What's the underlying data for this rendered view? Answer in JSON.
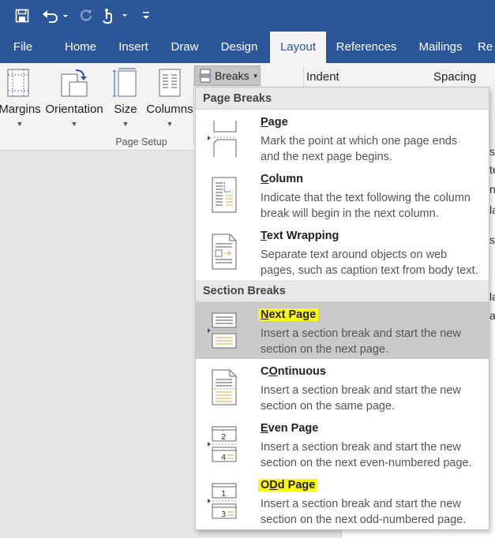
{
  "tabs": [
    "File",
    "Home",
    "Insert",
    "Draw",
    "Design",
    "Layout",
    "References",
    "Mailings",
    "Re"
  ],
  "active_tab": "Layout",
  "ribbon": {
    "margins": "Margins",
    "orientation": "Orientation",
    "size": "Size",
    "columns": "Columns",
    "group_label": "Page Setup",
    "breaks": "Breaks",
    "indent": "Indent",
    "spacing": "Spacing"
  },
  "doc_fragments": [
    "s",
    "te",
    "n",
    "la",
    "s",
    "la",
    "ar"
  ],
  "breaks_menu": {
    "page_breaks_header": "Page Breaks",
    "section_breaks_header": "Section Breaks",
    "items": [
      {
        "title_accel": "P",
        "title_rest": "age",
        "desc": [
          "Mark the point at which one page ends",
          "and the next page begins."
        ],
        "icon": "page-break-icon"
      },
      {
        "title_accel": "C",
        "title_rest": "olumn",
        "desc": [
          "Indicate that the text following the column",
          "break will begin in the next column."
        ],
        "icon": "column-break-icon"
      },
      {
        "title_accel": "T",
        "title_rest": "ext Wrapping",
        "desc": [
          "Separate text around objects on web",
          "pages, such as caption text from body text."
        ],
        "icon": "text-wrapping-icon"
      },
      {
        "title_accel": "N",
        "title_rest": "ext Page",
        "desc": [
          "Insert a section break and start the new",
          "section on the next page."
        ],
        "icon": "next-page-icon",
        "highlighted": true,
        "hover": true
      },
      {
        "title_accel": "O",
        "title_rest": "ntinuous",
        "title_pre": "C",
        "desc": [
          "Insert a section break and start the new",
          "section on the same page."
        ],
        "icon": "continuous-icon"
      },
      {
        "title_accel": "E",
        "title_rest": "ven Page",
        "desc": [
          "Insert a section break and start the new",
          "section on the next even-numbered page."
        ],
        "icon": "even-page-icon",
        "icon_number": "2"
      },
      {
        "title_accel": "D",
        "title_rest": "d Page",
        "title_pre": "O",
        "desc": [
          "Insert a section break and start the new",
          "section on the next odd-numbered page."
        ],
        "icon": "odd-page-icon",
        "highlighted": true,
        "icon_number": "1"
      }
    ]
  },
  "even_icon_numbers": [
    "2",
    "4"
  ],
  "odd_icon_numbers": [
    "1",
    "3"
  ],
  "colors": {
    "brand": "#2b579a",
    "highlight": "#ffff00",
    "hover": "#c9c9c9"
  }
}
